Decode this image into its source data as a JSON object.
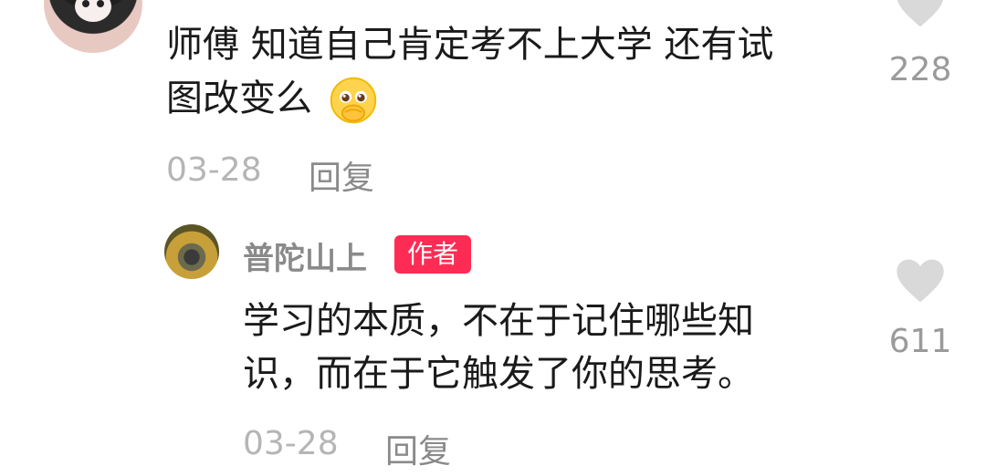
{
  "comment1": {
    "text_line1": "师傅 知道自己肯定考不上大学 还有试",
    "text_line2": "图改变么",
    "emoji": "pleading-face-emoji",
    "date": "03-28",
    "reply_label": "回复",
    "likes": "228"
  },
  "reply1": {
    "username": "普陀山上",
    "badge": "作者",
    "text_line1": "学习的本质，不在于记住哪些知",
    "text_line2": "识，而在于它触发了你的思考。",
    "date": "03-28",
    "reply_label": "回复",
    "likes": "611"
  },
  "colors": {
    "badge_bg": "#fe2c55",
    "meta_text": "#b5b5b5",
    "main_text": "#1a1a1a",
    "like_icon": "#d9d9d9"
  }
}
